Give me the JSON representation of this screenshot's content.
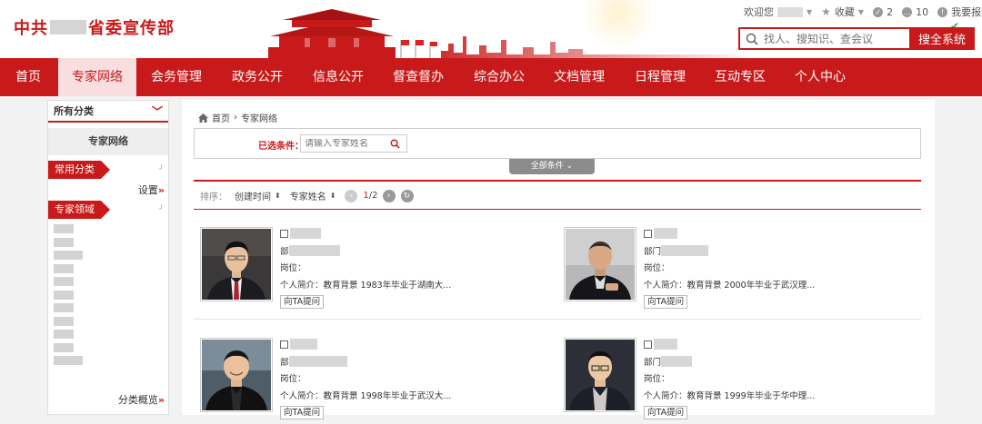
{
  "header": {
    "title_prefix": "中共",
    "title_suffix": "省委宣传部",
    "welcome": "欢迎您",
    "favorites": "收藏",
    "count_a": "2",
    "count_b": "10",
    "report": "我要报障",
    "search_placeholder": "找人、搜知识、查会议",
    "search_button": "搜全系统",
    "accent_color": "#c81a1a"
  },
  "nav": {
    "items": [
      {
        "label": "首页"
      },
      {
        "label": "专家网络"
      },
      {
        "label": "会务管理"
      },
      {
        "label": "政务公开"
      },
      {
        "label": "信息公开"
      },
      {
        "label": "督查督办"
      },
      {
        "label": "综合办公"
      },
      {
        "label": "文档管理"
      },
      {
        "label": "日程管理"
      },
      {
        "label": "互动专区"
      },
      {
        "label": "个人中心"
      }
    ],
    "active_index": 1
  },
  "sidebar": {
    "category_select": "所有分类",
    "title": "专家网络",
    "common_section": "常用分类",
    "settings": "设置",
    "field_section": "专家领域",
    "overview": "分类概览"
  },
  "main": {
    "breadcrumb": {
      "home": "首页",
      "current": "专家网络"
    },
    "filter_label": "已选条件：",
    "filter_placeholder": "请输入专家姓名",
    "all_conditions": "全部条件",
    "sort": {
      "label": "排序：",
      "by_time": "创建时间",
      "by_name": "专家姓名"
    },
    "pagination": {
      "current": "1",
      "separator": "/",
      "total": "2"
    },
    "experts": [
      {
        "dept_label": "部",
        "position_label": "岗位：",
        "bio": "个人简介：教育背景 1983年毕业于湖南大...",
        "ask_button": "向TA提问"
      },
      {
        "dept_label": "部门",
        "position_label": "岗位：",
        "bio": "个人简介：教育背景 2000年毕业于武汉理...",
        "ask_button": "向TA提问"
      },
      {
        "dept_label": "部",
        "position_label": "岗位：",
        "bio": "个人简介：教育背景 1998年毕业于武汉大...",
        "ask_button": "向TA提问"
      },
      {
        "dept_label": "部门",
        "position_label": "岗位：",
        "bio": "个人简介：教育背景 1999年毕业于华中理...",
        "ask_button": "向TA提问"
      }
    ]
  }
}
